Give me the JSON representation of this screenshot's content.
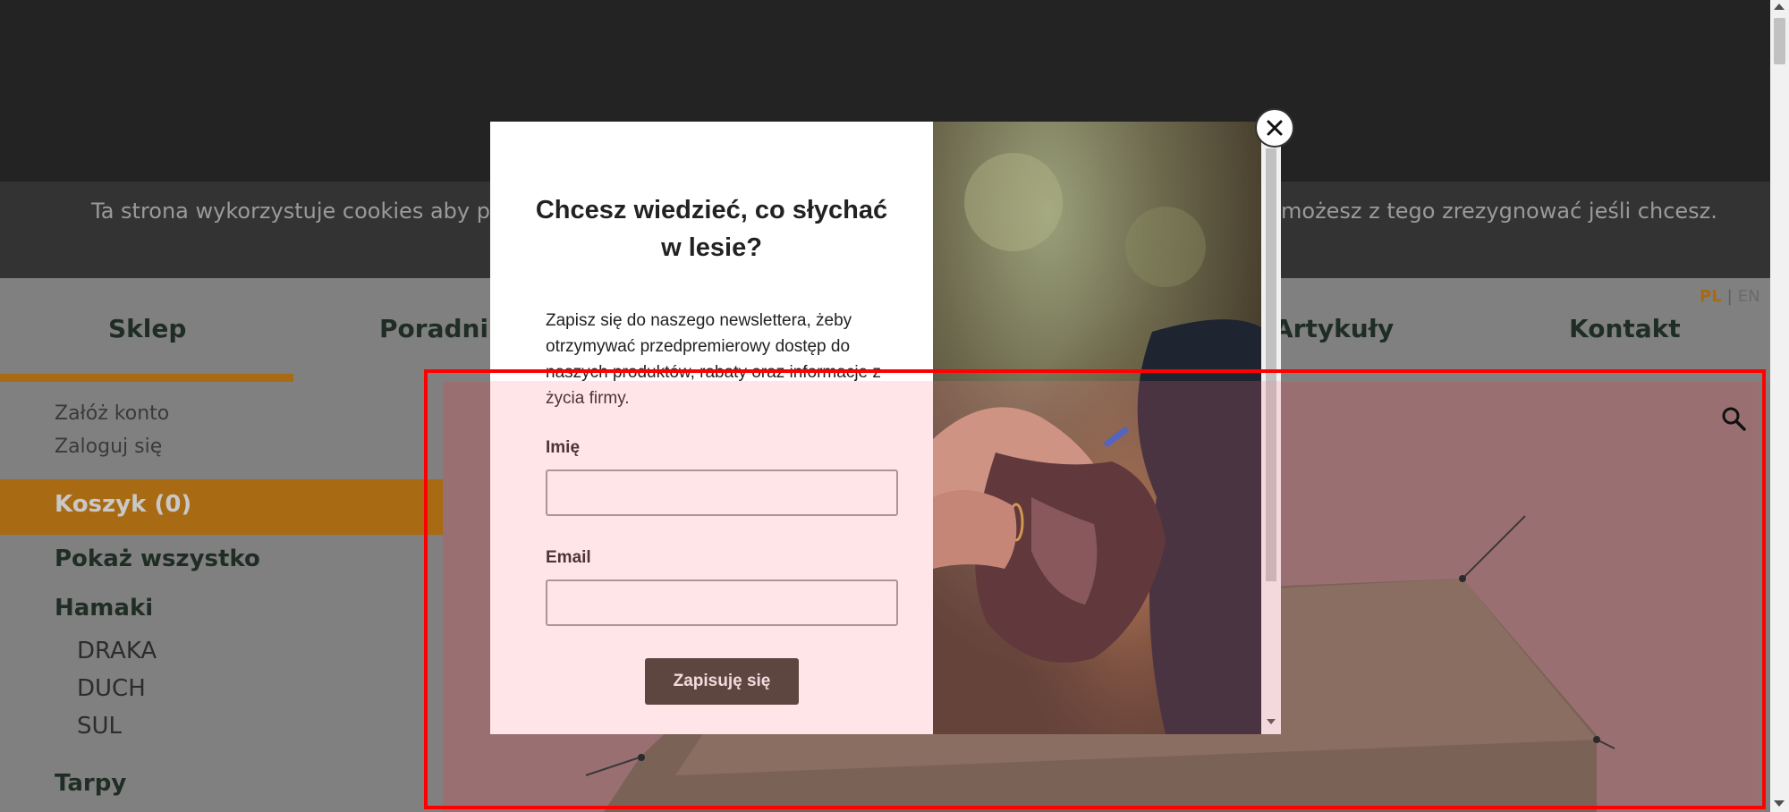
{
  "cookie_banner": {
    "text_left": "Ta strona wykorzystuje cookies aby pop",
    "text_right": "możesz z tego zrezygnować jeśli chcesz."
  },
  "nav": {
    "items": [
      {
        "label": "Sklep"
      },
      {
        "label": "Poradnik"
      },
      {
        "label": "Artykuły"
      },
      {
        "label": "Kontakt"
      }
    ],
    "lang_pl": "PL",
    "lang_sep": "|",
    "lang_en": "EN"
  },
  "sidebar": {
    "create_account": "Załóż konto",
    "login": "Zaloguj się",
    "cart": "Koszyk (0)",
    "show_all": "Pokaż wszystko",
    "categories": [
      {
        "label": "Hamaki",
        "subs": [
          "DRAKA",
          "DUCH",
          "SUL"
        ]
      },
      {
        "label": "Tarpy"
      }
    ]
  },
  "modal": {
    "title": "Chcesz wiedzieć, co słychać w lesie?",
    "description": "Zapisz się do naszego newslettera, żeby otrzymywać przedpremierowy dostęp do naszych produktów, rabaty oraz informacje z życia firmy.",
    "name_label": "Imię",
    "name_value": "",
    "email_label": "Email",
    "email_value": "",
    "submit_label": "Zapisuję się",
    "close_icon": "close-icon"
  },
  "icons": {
    "search": "search-icon"
  },
  "colors": {
    "accent": "#a86a12",
    "nav_text": "#1f2d24",
    "button_bg": "#353a2d",
    "highlight": "#ff0000"
  }
}
